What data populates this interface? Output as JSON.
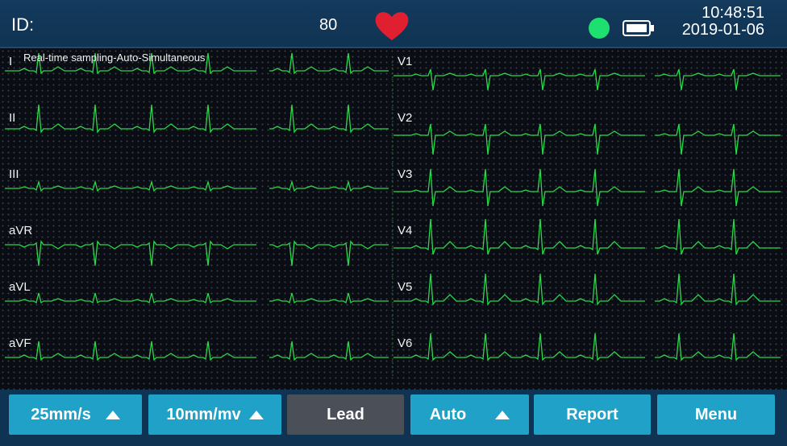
{
  "header": {
    "id_label": "ID:",
    "heart_rate": "80",
    "time": "10:48:51",
    "date": "2019-01-06",
    "status_color": "#1ee070",
    "heart_color": "#e02030"
  },
  "ecg": {
    "mode_caption": "Real-time sampling-Auto-Simultaneous",
    "left_leads": [
      "I",
      "II",
      "III",
      "aVR",
      "aVL",
      "aVF"
    ],
    "right_leads": [
      "V1",
      "V2",
      "V3",
      "V4",
      "V5",
      "V6"
    ],
    "trace_color": "#2bd84a"
  },
  "toolbar": {
    "speed_label": "25mm/s",
    "gain_label": "10mm/mv",
    "lead_label": "Lead",
    "mode_label": "Auto",
    "report_label": "Report",
    "menu_label": "Menu"
  }
}
